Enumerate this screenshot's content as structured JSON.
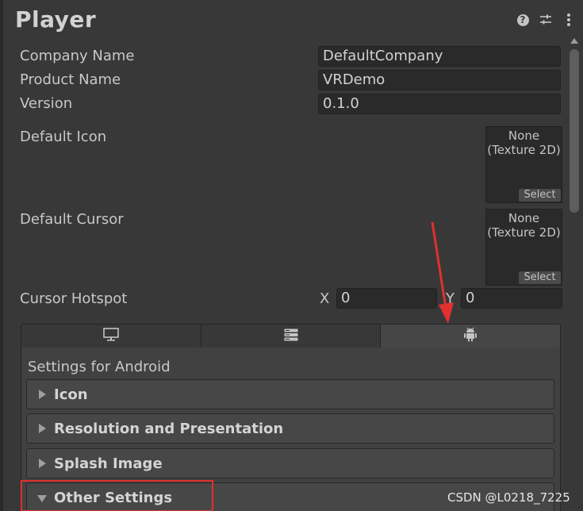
{
  "header": {
    "title": "Player",
    "help_icon": "?"
  },
  "fields": {
    "company_name_label": "Company Name",
    "company_name_value": "DefaultCompany",
    "product_name_label": "Product Name",
    "product_name_value": "VRDemo",
    "version_label": "Version",
    "version_value": "0.1.0",
    "default_icon_label": "Default Icon",
    "default_cursor_label": "Default Cursor",
    "texture_none_line1": "None",
    "texture_none_line2": "(Texture 2D)",
    "select_label": "Select",
    "cursor_hotspot_label": "Cursor Hotspot",
    "hotspot_x_label": "X",
    "hotspot_x_value": "0",
    "hotspot_y_label": "Y",
    "hotspot_y_value": "0"
  },
  "platform_tabs": [
    {
      "icon": "monitor-icon"
    },
    {
      "icon": "server-icon"
    },
    {
      "icon": "android-icon",
      "selected": true
    }
  ],
  "settings": {
    "heading": "Settings for Android",
    "foldouts": [
      {
        "label": "Icon",
        "expanded": false
      },
      {
        "label": "Resolution and Presentation",
        "expanded": false
      },
      {
        "label": "Splash Image",
        "expanded": false
      },
      {
        "label": "Other Settings",
        "expanded": true
      }
    ]
  },
  "watermark": "CSDN @L0218_7225",
  "colors": {
    "highlight": "#e0302f",
    "background": "#383838"
  }
}
